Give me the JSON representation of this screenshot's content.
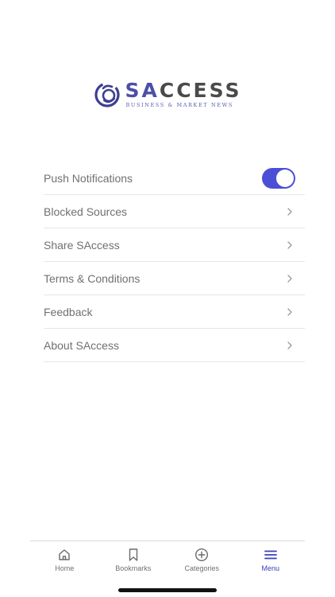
{
  "logo": {
    "word_accent": "SA",
    "word_rest": "CCESS",
    "tagline": "BUSINESS & MARKET NEWS"
  },
  "menu": {
    "items": [
      {
        "label": "Push Notifications",
        "control": "toggle",
        "toggle_on": true
      },
      {
        "label": "Blocked Sources",
        "control": "chevron-right-icon"
      },
      {
        "label": "Share SAccess",
        "control": "chevron-right-icon"
      },
      {
        "label": "Terms & Conditions",
        "control": "chevron-right-icon"
      },
      {
        "label": "Feedback",
        "control": "chevron-right-icon"
      },
      {
        "label": "About SAccess",
        "control": "chevron-right-icon"
      }
    ]
  },
  "tabbar": {
    "tabs": [
      {
        "label": "Home",
        "icon": "home-icon",
        "active": false
      },
      {
        "label": "Bookmarks",
        "icon": "bookmark-icon",
        "active": false
      },
      {
        "label": "Categories",
        "icon": "plus-circle-icon",
        "active": false
      },
      {
        "label": "Menu",
        "icon": "menu-icon",
        "active": true
      }
    ]
  },
  "colors": {
    "accent": "#4b4fd6",
    "brand": "#4b4fa8",
    "active_tab": "#3b3fb8",
    "text": "#707070",
    "divider": "#e6e6e6"
  }
}
